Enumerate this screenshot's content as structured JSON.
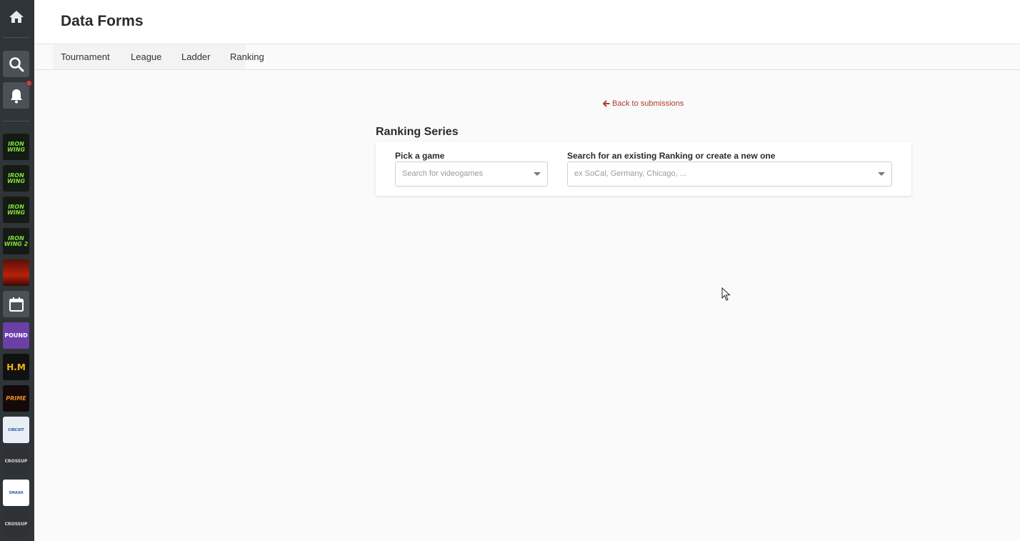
{
  "header": {
    "title": "Data Forms"
  },
  "tabs": [
    {
      "label": "Tournament"
    },
    {
      "label": "League"
    },
    {
      "label": "Ladder"
    },
    {
      "label": "Ranking"
    }
  ],
  "back_link": {
    "label": "Back to submissions",
    "icon": "arrow-left-icon"
  },
  "section": {
    "title": "Ranking Series"
  },
  "form": {
    "game": {
      "label": "Pick a game",
      "placeholder": "Search for videogames"
    },
    "ranking": {
      "label": "Search for an existing Ranking or create a new one",
      "placeholder": "ex SoCal, Germany, Chicago, ..."
    }
  },
  "sidebar": {
    "tiles": [
      {
        "text": "IRON WING",
        "name": "iron-wing"
      },
      {
        "text": "IRON WING",
        "name": "iron-wing"
      },
      {
        "text": "IRON WING",
        "name": "iron-wing"
      },
      {
        "text": "IRON WING 2",
        "name": "iron-wing-2"
      },
      {
        "text": "",
        "name": "red-event"
      },
      {
        "text": "",
        "name": "calendar"
      },
      {
        "text": "POUND",
        "name": "pound"
      },
      {
        "text": "H.M",
        "name": "hm-productions"
      },
      {
        "text": "PRIME",
        "name": "prime"
      },
      {
        "text": "CIRCUIT",
        "name": "circuit"
      },
      {
        "text": "CROSSUP",
        "name": "crossup"
      },
      {
        "text": "SMASH",
        "name": "smash"
      },
      {
        "text": "CROSSUP",
        "name": "crossup"
      }
    ]
  },
  "colors": {
    "sidebar": "#2e3438",
    "accent": "#b03a2e",
    "notification": "#d13c3c"
  }
}
